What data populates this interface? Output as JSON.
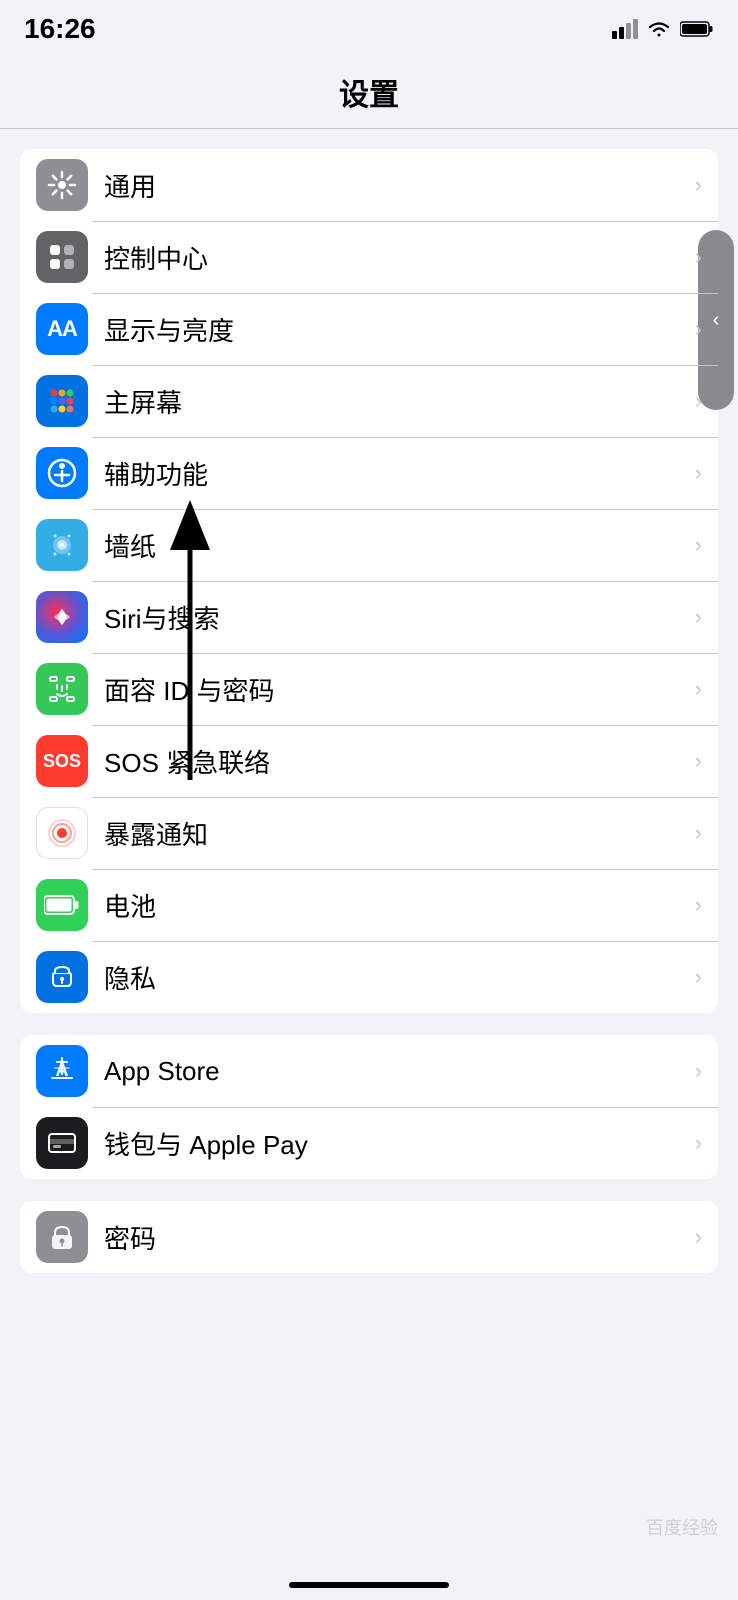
{
  "statusBar": {
    "time": "16:26"
  },
  "navBar": {
    "title": "设置"
  },
  "settingsGroups": [
    {
      "id": "group1",
      "items": [
        {
          "id": "tongyong",
          "label": "通用",
          "iconBg": "icon-gray",
          "iconType": "gear"
        },
        {
          "id": "kongzhizhongxin",
          "label": "控制中心",
          "iconBg": "icon-gray2",
          "iconType": "toggles"
        },
        {
          "id": "xianshiyuliangdu",
          "label": "显示与亮度",
          "iconBg": "icon-blue",
          "iconType": "AA"
        },
        {
          "id": "zhupingmu",
          "label": "主屏幕",
          "iconBg": "icon-blue2",
          "iconType": "grid"
        },
        {
          "id": "fuzhugneng",
          "label": "辅助功能",
          "iconBg": "icon-blue",
          "iconType": "accessibility"
        },
        {
          "id": "qiangzhi",
          "label": "墙纸",
          "iconBg": "icon-cyan",
          "iconType": "wallpaper"
        },
        {
          "id": "siri",
          "label": "Siri与搜索",
          "iconBg": "icon-black",
          "iconType": "siri"
        },
        {
          "id": "mianrong",
          "label": "面容 ID 与密码",
          "iconBg": "icon-green",
          "iconType": "faceid"
        },
        {
          "id": "sos",
          "label": "SOS 紧急联络",
          "iconBg": "icon-red",
          "iconType": "sos"
        },
        {
          "id": "baolu",
          "label": "暴露通知",
          "iconBg": "icon-white",
          "iconType": "exposure"
        },
        {
          "id": "dianchi",
          "label": "电池",
          "iconBg": "icon-green2",
          "iconType": "battery"
        },
        {
          "id": "yinsi",
          "label": "隐私",
          "iconBg": "icon-blue2",
          "iconType": "hand"
        }
      ]
    },
    {
      "id": "group2",
      "items": [
        {
          "id": "appstore",
          "label": "App Store",
          "iconBg": "icon-blue",
          "iconType": "appstore"
        },
        {
          "id": "applepay",
          "label": "钱包与 Apple Pay",
          "iconBg": "icon-black",
          "iconType": "wallet"
        }
      ]
    },
    {
      "id": "group3",
      "items": [
        {
          "id": "mima",
          "label": "密码",
          "iconBg": "icon-gray",
          "iconType": "key"
        }
      ]
    }
  ],
  "chevron": "›"
}
